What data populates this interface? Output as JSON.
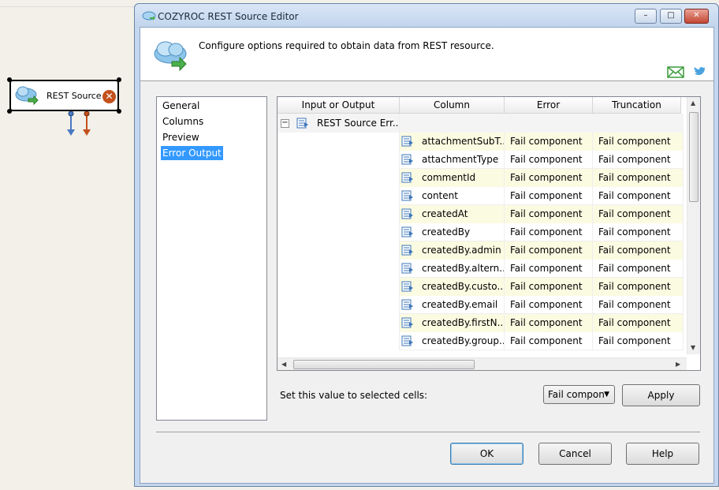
{
  "canvas": {
    "component_label": "REST Source"
  },
  "window": {
    "title": "COZYROC REST Source Editor",
    "controls": {
      "minimize": "–",
      "maximize": "□",
      "close": "✕"
    }
  },
  "header": {
    "description": "Configure options required to obtain data from REST resource."
  },
  "nav": {
    "items": [
      {
        "label": "General"
      },
      {
        "label": "Columns"
      },
      {
        "label": "Preview"
      },
      {
        "label": "Error Output"
      }
    ],
    "selected": "Error Output"
  },
  "grid": {
    "columns": [
      "Input or Output",
      "Column",
      "Error",
      "Truncation"
    ],
    "group": {
      "label": "REST Source Err...",
      "expander": "−"
    },
    "rows": [
      {
        "column": "attachmentSubT...",
        "error": "Fail component",
        "truncation": "Fail component"
      },
      {
        "column": "attachmentType",
        "error": "Fail component",
        "truncation": "Fail component"
      },
      {
        "column": "commentId",
        "error": "Fail component",
        "truncation": "Fail component"
      },
      {
        "column": "content",
        "error": "Fail component",
        "truncation": "Fail component"
      },
      {
        "column": "createdAt",
        "error": "Fail component",
        "truncation": "Fail component"
      },
      {
        "column": "createdBy",
        "error": "Fail component",
        "truncation": "Fail component"
      },
      {
        "column": "createdBy.admin",
        "error": "Fail component",
        "truncation": "Fail component"
      },
      {
        "column": "createdBy.altern...",
        "error": "Fail component",
        "truncation": "Fail component"
      },
      {
        "column": "createdBy.custo...",
        "error": "Fail component",
        "truncation": "Fail component"
      },
      {
        "column": "createdBy.email",
        "error": "Fail component",
        "truncation": "Fail component"
      },
      {
        "column": "createdBy.firstN...",
        "error": "Fail component",
        "truncation": "Fail component"
      },
      {
        "column": "createdBy.group...",
        "error": "Fail component",
        "truncation": "Fail component"
      }
    ]
  },
  "set_value": {
    "label": "Set this value to selected cells:",
    "dropdown_value": "Fail compon",
    "apply_label": "Apply"
  },
  "buttons": {
    "ok": "OK",
    "cancel": "Cancel",
    "help": "Help"
  },
  "colors": {
    "selection": "#3399ff",
    "row_alt": "#fbfbe2",
    "error_badge": "#c4501c",
    "arrow_blue": "#4a78c2",
    "arrow_orange": "#c4501c"
  }
}
